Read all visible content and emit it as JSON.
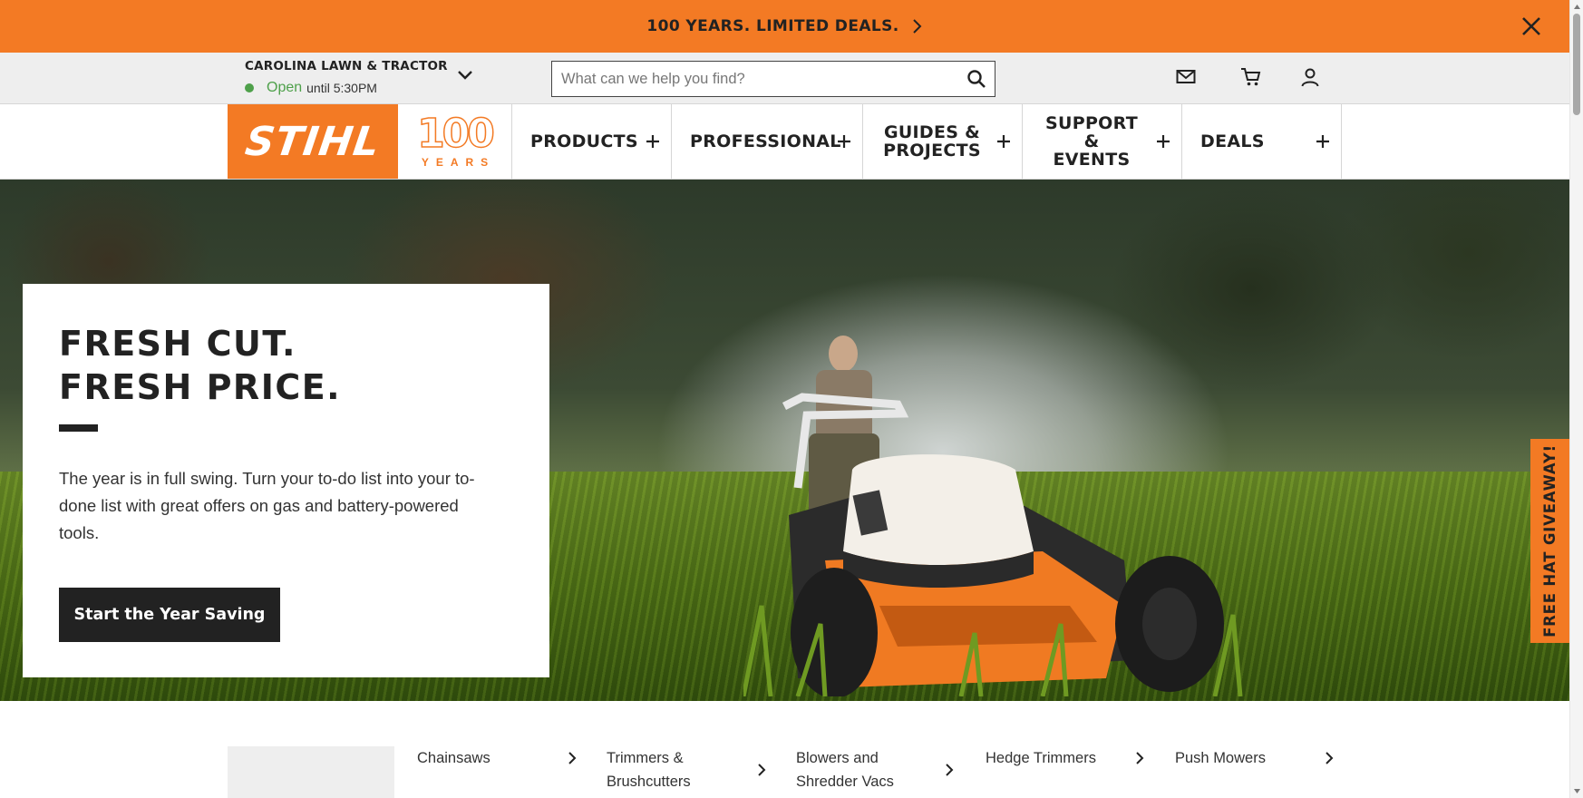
{
  "promo": {
    "text": "100 YEARS. LIMITED DEALS."
  },
  "store": {
    "name": "CAROLINA LAWN & TRACTOR",
    "status": "Open",
    "hours": "until 5:30PM"
  },
  "search": {
    "placeholder": "What can we help you find?"
  },
  "logo": {
    "brand": "STIHL",
    "anniversary_number": "100",
    "anniversary_word": "YEARS"
  },
  "nav": {
    "products": "PRODUCTS",
    "professional": "PROFESSIONAL",
    "guides_line1": "GUIDES &",
    "guides_line2": "PROJECTS",
    "support_line1": "SUPPORT &",
    "support_line2": "EVENTS",
    "deals": "DEALS"
  },
  "hero": {
    "title": "FRESH CUT.\nFRESH PRICE.",
    "body": "The year is in full swing. Turn your to-do list into your to-done list with great offers on gas and battery-powered tools.",
    "cta": "Start the Year Saving"
  },
  "giveaway": {
    "label": "FREE HAT GIVEAWAY!"
  },
  "categories": {
    "chainsaws": "Chainsaws",
    "trimmers_line1": "Trimmers &",
    "trimmers_line2": "Brushcutters",
    "blowers_line1": "Blowers and",
    "blowers_line2": "Shredder Vacs",
    "hedge": "Hedge Trimmers",
    "mowers": "Push Mowers"
  },
  "colors": {
    "brand_orange": "#f37a24",
    "open_green": "#4ea04a",
    "dark": "#222222"
  },
  "icons": [
    "chevron-right-icon",
    "close-icon",
    "chevron-down-icon",
    "search-icon",
    "mail-icon",
    "cart-icon",
    "account-icon",
    "plus-icon"
  ]
}
